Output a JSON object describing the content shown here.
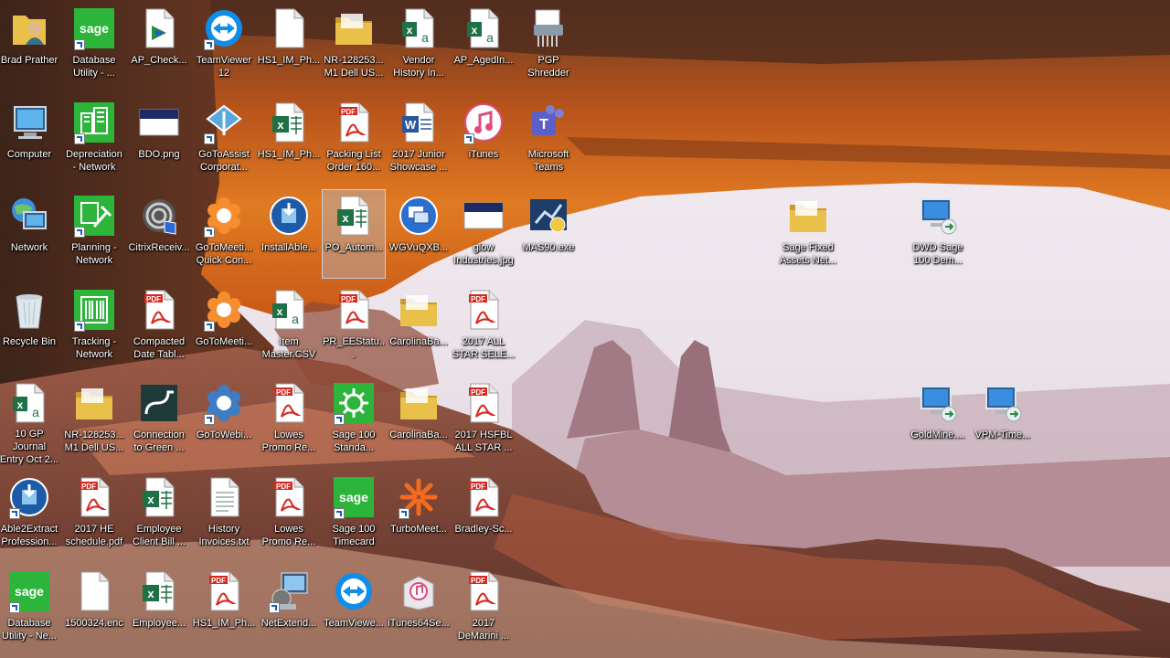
{
  "desktop": {
    "icons": [
      {
        "label": "Brad Prather",
        "icon": "user-folder-icon",
        "slug": "brad-prather",
        "col": 0,
        "row": 0,
        "shortcut": false
      },
      {
        "label": "Database\nUtility - ...",
        "icon": "sage-icon",
        "slug": "database-utility",
        "col": 1,
        "row": 0,
        "shortcut": true
      },
      {
        "label": "AP_Check...",
        "icon": "document-icon",
        "slug": "ap-check",
        "col": 2,
        "row": 0,
        "shortcut": false
      },
      {
        "label": "TeamViewer\n12",
        "icon": "teamviewer-icon",
        "slug": "teamviewer-12",
        "col": 3,
        "row": 0,
        "shortcut": true
      },
      {
        "label": "HS1_IM_Ph...",
        "icon": "blank-file-icon",
        "slug": "hs1-im-ph-1",
        "col": 4,
        "row": 0,
        "shortcut": false
      },
      {
        "label": "NR-128253...\nM1 Dell US...",
        "icon": "folder-icon",
        "slug": "nr-128253-1",
        "col": 5,
        "row": 0,
        "shortcut": false
      },
      {
        "label": "Vendor\nHistory In...",
        "icon": "excel-csv-icon",
        "slug": "vendor-history",
        "col": 6,
        "row": 0,
        "shortcut": false
      },
      {
        "label": "AP_AgedIn...",
        "icon": "excel-csv-icon",
        "slug": "ap-agedin",
        "col": 7,
        "row": 0,
        "shortcut": false
      },
      {
        "label": "PGP\nShredder",
        "icon": "shredder-icon",
        "slug": "pgp-shredder",
        "col": 8,
        "row": 0,
        "shortcut": false
      },
      {
        "label": "Computer",
        "icon": "computer-icon",
        "slug": "computer",
        "col": 0,
        "row": 1,
        "shortcut": false
      },
      {
        "label": "Depreciation\n- Network",
        "icon": "sage-building-icon",
        "slug": "depreciation-network",
        "col": 1,
        "row": 1,
        "shortcut": true
      },
      {
        "label": "BDO.png",
        "icon": "image-file-icon",
        "slug": "bdo-png",
        "col": 2,
        "row": 1,
        "shortcut": false
      },
      {
        "label": "GoToAssist\nCorporat...",
        "icon": "gotoassist-icon",
        "slug": "gotoassist",
        "col": 3,
        "row": 1,
        "shortcut": true
      },
      {
        "label": "HS1_IM_Ph...",
        "icon": "excel-icon",
        "slug": "hs1-im-ph-2",
        "col": 4,
        "row": 1,
        "shortcut": false
      },
      {
        "label": "Packing List\nOrder 160...",
        "icon": "pdf-icon",
        "slug": "packing-list",
        "col": 5,
        "row": 1,
        "shortcut": false
      },
      {
        "label": "2017 Junior\nShowcase ...",
        "icon": "word-icon",
        "slug": "junior-showcase",
        "col": 6,
        "row": 1,
        "shortcut": false
      },
      {
        "label": "iTunes",
        "icon": "itunes-icon",
        "slug": "itunes",
        "col": 7,
        "row": 1,
        "shortcut": true
      },
      {
        "label": "Microsoft\nTeams",
        "icon": "teams-icon",
        "slug": "microsoft-teams",
        "col": 8,
        "row": 1,
        "shortcut": false
      },
      {
        "label": "Network",
        "icon": "network-icon",
        "slug": "network",
        "col": 0,
        "row": 2,
        "shortcut": false
      },
      {
        "label": "Planning -\nNetwork",
        "icon": "sage-hammer-icon",
        "slug": "planning-network",
        "col": 1,
        "row": 2,
        "shortcut": true
      },
      {
        "label": "CitrixReceiv...",
        "icon": "citrix-icon",
        "slug": "citrix-receiver",
        "col": 2,
        "row": 2,
        "shortcut": false
      },
      {
        "label": "GoToMeeti...\nQuick Con...",
        "icon": "gotomeeting-icon",
        "slug": "gotomeeting-quick",
        "col": 3,
        "row": 2,
        "shortcut": true
      },
      {
        "label": "InstallAble...",
        "icon": "installer-icon",
        "slug": "install-able",
        "col": 4,
        "row": 2,
        "shortcut": false
      },
      {
        "label": "PO_Autom...",
        "icon": "excel-icon",
        "slug": "po-autom",
        "col": 5,
        "row": 2,
        "shortcut": false,
        "selected": true
      },
      {
        "label": "WGVuQXB...",
        "icon": "app-window-icon",
        "slug": "wgvuqxb",
        "col": 6,
        "row": 2,
        "shortcut": false
      },
      {
        "label": "glow\nIndustries.jpg",
        "icon": "image-file-icon",
        "slug": "glow-industries",
        "col": 7,
        "row": 2,
        "shortcut": false
      },
      {
        "label": "MAS90.exe",
        "icon": "mas90-icon",
        "slug": "mas90",
        "col": 8,
        "row": 2,
        "shortcut": false
      },
      {
        "label": "Recycle Bin",
        "icon": "recycle-bin-icon",
        "slug": "recycle-bin",
        "col": 0,
        "row": 3,
        "shortcut": false
      },
      {
        "label": "Tracking -\nNetwork",
        "icon": "sage-barcode-icon",
        "slug": "tracking-network",
        "col": 1,
        "row": 3,
        "shortcut": true
      },
      {
        "label": "Compacted\nDate Tabl...",
        "icon": "pdf-icon",
        "slug": "compacted-date",
        "col": 2,
        "row": 3,
        "shortcut": false
      },
      {
        "label": "GoToMeeti...",
        "icon": "gotomeeting-icon",
        "slug": "gotomeeting",
        "col": 3,
        "row": 3,
        "shortcut": true
      },
      {
        "label": "Item\nMaster.CSV",
        "icon": "excel-csv-icon",
        "slug": "item-master",
        "col": 4,
        "row": 3,
        "shortcut": false
      },
      {
        "label": "PR_EEStatu...",
        "icon": "pdf-icon",
        "slug": "pr-eestatu",
        "col": 5,
        "row": 3,
        "shortcut": false
      },
      {
        "label": "CarolinaBa...",
        "icon": "folder-icon",
        "slug": "carolinaba-1",
        "col": 6,
        "row": 3,
        "shortcut": false
      },
      {
        "label": "2017 ALL\nSTAR SELE...",
        "icon": "pdf-icon",
        "slug": "all-star-sele",
        "col": 7,
        "row": 3,
        "shortcut": false
      },
      {
        "label": "10 GP Journal\nEntry Oct 2...",
        "icon": "excel-csv-icon",
        "slug": "gp-journal",
        "col": 0,
        "row": 4,
        "shortcut": false
      },
      {
        "label": "NR-128253...\nM1 Dell US...",
        "icon": "folder-icon",
        "slug": "nr-128253-2",
        "col": 1,
        "row": 4,
        "shortcut": false
      },
      {
        "label": "Connection\nto Green ...",
        "icon": "connection-icon",
        "slug": "connection-green",
        "col": 2,
        "row": 4,
        "shortcut": false
      },
      {
        "label": "GoToWebi...",
        "icon": "gotowebinar-icon",
        "slug": "gotowebinar",
        "col": 3,
        "row": 4,
        "shortcut": true
      },
      {
        "label": "Lowes\nPromo Re...",
        "icon": "pdf-icon",
        "slug": "lowes-promo-1",
        "col": 4,
        "row": 4,
        "shortcut": false
      },
      {
        "label": "Sage 100\nStanda...",
        "icon": "sage-gear-icon",
        "slug": "sage100-standard",
        "col": 5,
        "row": 4,
        "shortcut": true
      },
      {
        "label": "CarolinaBa...",
        "icon": "folder-icon",
        "slug": "carolinaba-2",
        "col": 6,
        "row": 4,
        "shortcut": false
      },
      {
        "label": "2017 HSFBL\nALL STAR ...",
        "icon": "pdf-icon",
        "slug": "hsfbl-all-star",
        "col": 7,
        "row": 4,
        "shortcut": false
      },
      {
        "label": "Able2Extract\nProfession...",
        "icon": "installer-icon",
        "slug": "able2extract",
        "col": 0,
        "row": 5,
        "shortcut": true
      },
      {
        "label": "2017 HE\nschedule.pdf",
        "icon": "pdf-icon",
        "slug": "he-schedule",
        "col": 1,
        "row": 5,
        "shortcut": false
      },
      {
        "label": "Employee\nClient Bill ...",
        "icon": "excel-icon",
        "slug": "employee-client-bill",
        "col": 2,
        "row": 5,
        "shortcut": false
      },
      {
        "label": "History\nInvoices.txt",
        "icon": "text-file-icon",
        "slug": "history-invoices",
        "col": 3,
        "row": 5,
        "shortcut": false
      },
      {
        "label": "Lowes\nPromo Re...",
        "icon": "pdf-icon",
        "slug": "lowes-promo-2",
        "col": 4,
        "row": 5,
        "shortcut": false
      },
      {
        "label": "Sage 100\nTimecard",
        "icon": "sage-icon",
        "slug": "sage100-timecard",
        "col": 5,
        "row": 5,
        "shortcut": true
      },
      {
        "label": "TurboMeet...",
        "icon": "turbomeeting-icon",
        "slug": "turbomeeting",
        "col": 6,
        "row": 5,
        "shortcut": true
      },
      {
        "label": "Bradley-Sc...",
        "icon": "pdf-icon",
        "slug": "bradley-sc",
        "col": 7,
        "row": 5,
        "shortcut": false
      },
      {
        "label": "Database\nUtility - Ne...",
        "icon": "sage-icon",
        "slug": "database-utility-ne",
        "col": 0,
        "row": 6,
        "shortcut": true
      },
      {
        "label": "1500324.enc",
        "icon": "blank-file-icon",
        "slug": "enc-file",
        "col": 1,
        "row": 6,
        "shortcut": false
      },
      {
        "label": "Employee...",
        "icon": "excel-icon",
        "slug": "employee",
        "col": 2,
        "row": 6,
        "shortcut": false
      },
      {
        "label": "HS1_IM_Ph...",
        "icon": "pdf-icon",
        "slug": "hs1-im-ph-3",
        "col": 3,
        "row": 6,
        "shortcut": false
      },
      {
        "label": "NetExtend...",
        "icon": "netextender-icon",
        "slug": "netextender",
        "col": 4,
        "row": 6,
        "shortcut": true
      },
      {
        "label": "TeamViewe...",
        "icon": "teamviewer-icon",
        "slug": "teamviewer",
        "col": 5,
        "row": 6,
        "shortcut": false
      },
      {
        "label": "iTunes64Se...",
        "icon": "itunes-installer-icon",
        "slug": "itunes64setup",
        "col": 6,
        "row": 6,
        "shortcut": false
      },
      {
        "label": "2017\nDeMarini ...",
        "icon": "pdf-icon",
        "slug": "demarini",
        "col": 7,
        "row": 6,
        "shortcut": false
      },
      {
        "label": "Sage Fixed\nAssets Net...",
        "icon": "folder-icon",
        "slug": "sage-fixed-assets",
        "col": 12,
        "row": 2,
        "shortcut": false
      },
      {
        "label": "DWD Sage\n100 Dem...",
        "icon": "remote-desktop-icon",
        "slug": "dwd-sage-100",
        "col": 14,
        "row": 2,
        "shortcut": false
      },
      {
        "label": "GoldMine....",
        "icon": "remote-desktop-icon",
        "slug": "goldmine",
        "col": 14,
        "row": 4,
        "shortcut": false
      },
      {
        "label": "VPM-Time...",
        "icon": "remote-desktop-icon",
        "slug": "vpm-time",
        "col": 15,
        "row": 4,
        "shortcut": false
      }
    ]
  },
  "colors": {
    "sage_green": "#2db43a",
    "excel_green": "#1e7145",
    "word_blue": "#2b579a",
    "pdf_red": "#d8281e",
    "folder_yellow": "#e8c04a",
    "teamviewer_blue": "#0e8ee9",
    "teams_purple": "#5b5fc7",
    "gotomeeting_orange": "#f68d2e"
  }
}
